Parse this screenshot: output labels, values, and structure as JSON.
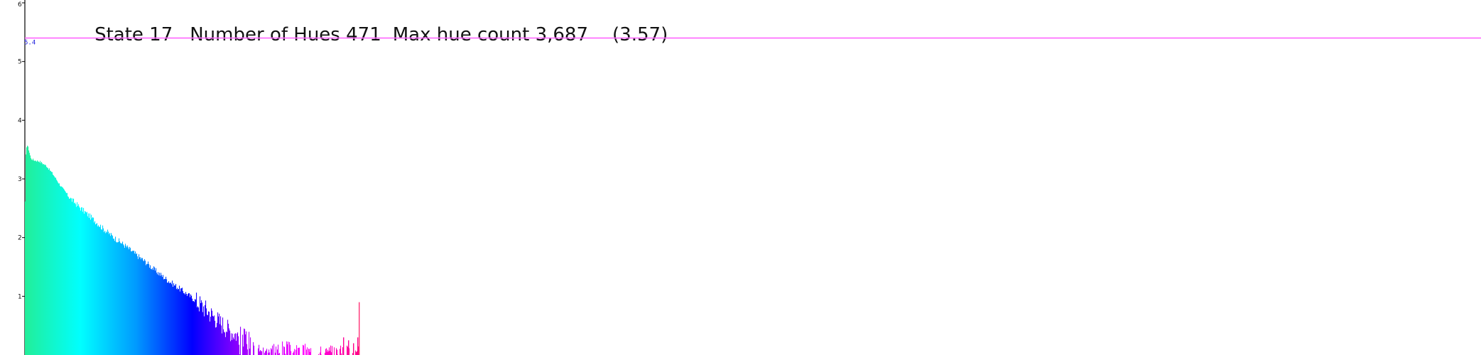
{
  "header": {
    "state": "State 17",
    "hues": "Number of Hues 471",
    "max": "Max hue count 3,687",
    "log_max": "(3.57)"
  },
  "chart_data": {
    "type": "bar",
    "y_scale": "log10 of hue count",
    "ylim": [
      0,
      6
    ],
    "y_ticks": [
      "1",
      "2",
      "3",
      "4",
      "5",
      "6"
    ],
    "grid": false,
    "legend": "none",
    "reference_line": {
      "value": 5.4,
      "label": "5.4",
      "color": "#ff66ff"
    },
    "max_hue_count": 3687,
    "max_log_value": 3.57,
    "bar_count": 471,
    "color_gradient": [
      "#22ee99",
      "#00ffff",
      "#0099ff",
      "#0000ff",
      "#aa00ff",
      "#ff00ff",
      "#ff0088"
    ],
    "profile": [
      [
        0,
        2.6
      ],
      [
        0.4,
        3.0
      ],
      [
        1.0,
        3.4
      ],
      [
        1.6,
        3.55
      ],
      [
        3,
        3.57
      ],
      [
        5,
        3.5
      ],
      [
        8,
        3.35
      ],
      [
        12,
        3.32
      ],
      [
        20,
        3.3
      ],
      [
        30,
        3.22
      ],
      [
        38,
        3.1
      ],
      [
        50,
        2.88
      ],
      [
        65,
        2.65
      ],
      [
        80,
        2.48
      ],
      [
        95,
        2.32
      ],
      [
        110,
        2.15
      ],
      [
        125,
        2.0
      ],
      [
        140,
        1.87
      ],
      [
        155,
        1.72
      ],
      [
        170,
        1.58
      ],
      [
        185,
        1.42
      ],
      [
        200,
        1.28
      ],
      [
        215,
        1.15
      ],
      [
        230,
        1.02
      ],
      [
        245,
        0.88
      ],
      [
        260,
        0.72
      ],
      [
        275,
        0.55
      ],
      [
        290,
        0.4
      ],
      [
        310,
        0.28
      ],
      [
        330,
        0.18
      ],
      [
        350,
        0.1
      ],
      [
        380,
        0.05
      ],
      [
        420,
        0.02
      ],
      [
        470,
        0.0
      ]
    ],
    "notable_bars": [
      {
        "hue_index": 470,
        "value": 0.9,
        "color": "#ff3377"
      },
      {
        "hue_index": 468,
        "value": 0.3,
        "color": "#ff0088"
      },
      {
        "hue_index": 462,
        "value": 0.2,
        "color": "#ff0088"
      },
      {
        "hue_index": 455,
        "value": 0.25,
        "color": "#ff0099"
      },
      {
        "hue_index": 448,
        "value": 0.3,
        "color": "#ff0099"
      }
    ]
  }
}
